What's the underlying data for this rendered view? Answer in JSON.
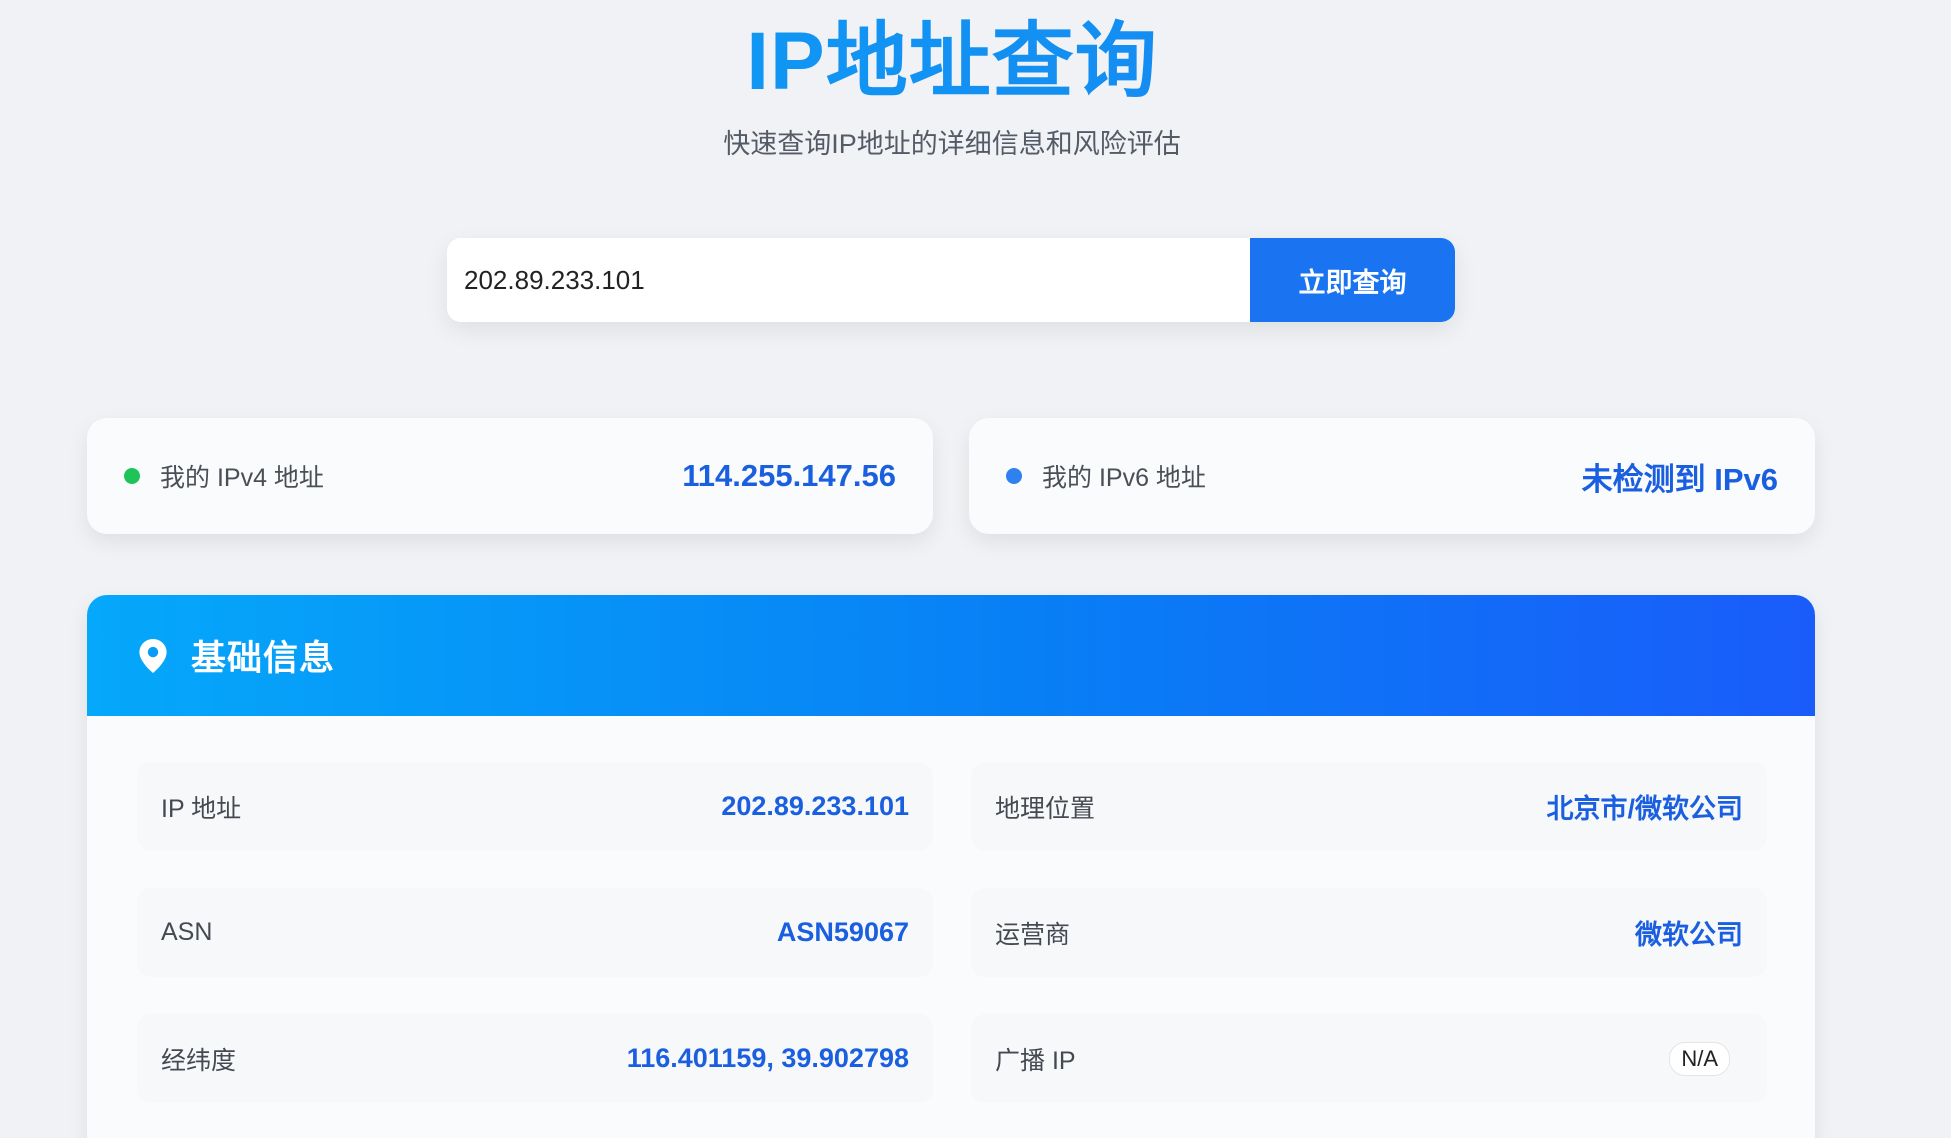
{
  "header": {
    "title": "IP地址查询",
    "subtitle": "快速查询IP地址的详细信息和风险评估"
  },
  "search": {
    "value": "202.89.233.101",
    "button_label": "立即查询"
  },
  "my_ip": {
    "ipv4_label": "我的 IPv4 地址",
    "ipv4_value": "114.255.147.56",
    "ipv4_dot_color": "#1ec45a",
    "ipv6_label": "我的 IPv6 地址",
    "ipv6_value": "未检测到 IPv6",
    "ipv6_dot_color": "#2f80f0"
  },
  "basic_info": {
    "title": "基础信息",
    "icon": "location-pin-icon",
    "rows": [
      {
        "key": "IP 地址",
        "value": "202.89.233.101"
      },
      {
        "key": "地理位置",
        "value": "北京市/微软公司"
      },
      {
        "key": "ASN",
        "value": "ASN59067"
      },
      {
        "key": "运营商",
        "value": "微软公司"
      },
      {
        "key": "经纬度",
        "value": "116.401159, 39.902798"
      },
      {
        "key": "广播 IP",
        "value": "N/A"
      }
    ]
  },
  "colors": {
    "accent": "#1a73f0",
    "value_text": "#1a5fe0",
    "background": "#f0f2f5"
  }
}
